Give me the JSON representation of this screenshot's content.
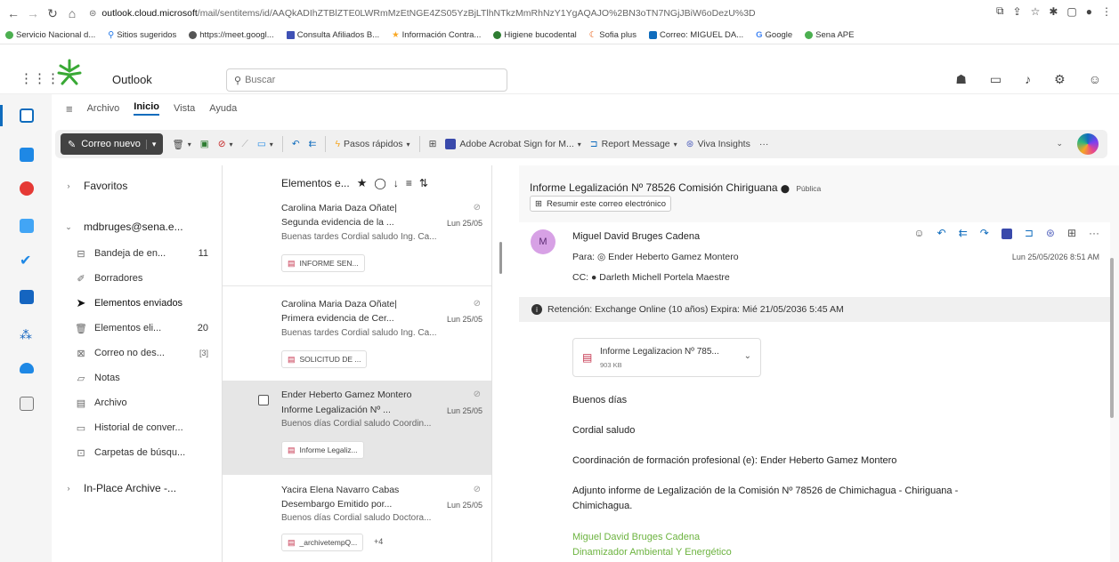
{
  "browser": {
    "url_host": "outlook.cloud.microsoft",
    "url_path": "/mail/sentitems/id/AAQkADIhZTBlZTE0LWRmMzEtNGE4ZS05YzBjLTlhNTkzMmRhNzY1YgAQAJO%2BN3oTN7NGjJBiW6oDezU%3D"
  },
  "bookmarks": [
    {
      "label": "Servicio Nacional d...",
      "color": "#4caf50"
    },
    {
      "label": "Sitios sugeridos",
      "color": "#1a73e8"
    },
    {
      "label": "https://meet.googl...",
      "color": "#555555"
    },
    {
      "label": "Consulta Afiliados B...",
      "color": "#3f51b5"
    },
    {
      "label": "Información Contra...",
      "color": "#f9a825"
    },
    {
      "label": "Higiene bucodental",
      "color": "#2e7d32"
    },
    {
      "label": "Sofia plus",
      "color": "#e65100"
    },
    {
      "label": "Correo: MIGUEL DA...",
      "color": "#0f6cbd"
    },
    {
      "label": "Google",
      "color": "#4285f4"
    },
    {
      "label": "Sena APE",
      "color": "#4caf50"
    }
  ],
  "header": {
    "app_name": "Outlook",
    "search_placeholder": "Buscar"
  },
  "ribbon": {
    "tabs": [
      "Archivo",
      "Inicio",
      "Vista",
      "Ayuda"
    ],
    "new_mail": "Correo nuevo",
    "quick_steps": "Pasos rápidos",
    "adobe": "Adobe Acrobat Sign for M...",
    "report": "Report Message",
    "viva": "Viva Insights"
  },
  "folders": {
    "favorites": "Favoritos",
    "account": "mdbruges@sena.e...",
    "items": [
      {
        "label": "Bandeja de en...",
        "count": "11",
        "icon": "inbox-icon"
      },
      {
        "label": "Borradores",
        "count": "",
        "icon": "drafts-icon"
      },
      {
        "label": "Elementos enviados",
        "count": "",
        "icon": "sent-icon"
      },
      {
        "label": "Elementos eli...",
        "count": "20",
        "icon": "trash-icon"
      },
      {
        "label": "Correo no des...",
        "count": "[3]",
        "icon": "junk-icon"
      },
      {
        "label": "Notas",
        "count": "",
        "icon": "notes-icon"
      },
      {
        "label": "Archivo",
        "count": "",
        "icon": "archive-icon"
      },
      {
        "label": "Historial de conver...",
        "count": "",
        "icon": "history-icon"
      },
      {
        "label": "Carpetas de búsqu...",
        "count": "",
        "icon": "search-folder-icon"
      }
    ],
    "in_place": "In-Place Archive -..."
  },
  "list": {
    "title": "Elementos e...",
    "messages": [
      {
        "from": "Carolina Maria Daza Oñate|",
        "subject": "Segunda evidencia de la ...",
        "date": "Lun 25/05",
        "preview": "Buenas tardes Cordial saludo Ing. Ca...",
        "attachment": "INFORME SEN...",
        "extra": ""
      },
      {
        "from": "Carolina Maria Daza Oñate|",
        "subject": "Primera evidencia de Cer...",
        "date": "Lun 25/05",
        "preview": "Buenas tardes Cordial saludo Ing. Ca...",
        "attachment": "SOLICITUD DE ...",
        "extra": ""
      },
      {
        "from": "Ender Heberto Gamez Montero",
        "subject": "Informe Legalización Nº ...",
        "date": "Lun 25/05",
        "preview": "Buenos días Cordial saludo Coordin...",
        "attachment": "Informe Legaliz...",
        "extra": ""
      },
      {
        "from": "Yacira Elena Navarro Cabas",
        "subject": "Desembargo Emitido por...",
        "date": "Lun 25/05",
        "preview": "Buenos días Cordial saludo Doctora...",
        "attachment": "_archivetempQ...",
        "extra": "+4"
      }
    ]
  },
  "reading": {
    "subject": "Informe Legalización Nº 78526 Comisión Chiriguana",
    "visibility": "Pública",
    "summarize": "Resumir este correo electrónico",
    "avatar": "M",
    "sender": "Miguel David Bruges Cadena",
    "to": "Para: ◎ Ender Heberto Gamez Montero",
    "cc": "CC: ● Darleth Michell Portela Maestre",
    "date": "Lun 25/05/2026 8:51 AM",
    "retention": "Retención: Exchange Online (10 años) Expira: Mié 21/05/2036 5:45 AM",
    "attachment_name": "Informe Legalizacion Nº 785...",
    "attachment_size": "903 KB",
    "body": [
      "Buenos días",
      "Cordial saludo",
      "Coordinación de formación profesional (e): Ender Heberto Gamez Montero",
      "Adjunto informe de Legalización de la Comisión Nº 78526 de Chimichagua - Chiriguana -",
      "Chimichagua."
    ],
    "signature": [
      "Miguel David Bruges Cadena",
      "Dinamizador Ambiental Y Energético"
    ]
  }
}
